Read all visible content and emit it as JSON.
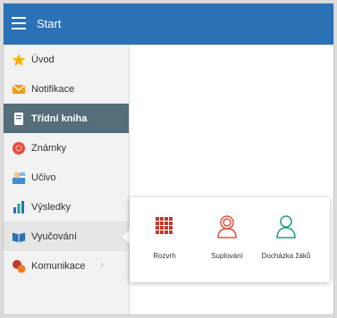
{
  "topbar": {
    "title": "Start",
    "background": "#2a71b5"
  },
  "sidebar": {
    "items": [
      {
        "label": "Úvod",
        "icon": "star-icon"
      },
      {
        "label": "Notifikace",
        "icon": "envelope-icon"
      },
      {
        "label": "Třídní kniha",
        "icon": "book-icon",
        "active": true
      },
      {
        "label": "Známky",
        "icon": "grades-icon"
      },
      {
        "label": "Učivo",
        "icon": "teacher-icon"
      },
      {
        "label": "Výsledky",
        "icon": "bar-chart-icon"
      },
      {
        "label": "Vyučování",
        "icon": "open-book-icon"
      },
      {
        "label": "Komunikace",
        "icon": "chat-icon"
      }
    ],
    "active_color": "#546e7a"
  },
  "submenu": {
    "tiles": [
      {
        "label": "Rozvrh",
        "icon": "calendar-grid-icon",
        "color": "#c0392b"
      },
      {
        "label": "Suplování",
        "icon": "person-substitute-icon",
        "color": "#e74c3c"
      },
      {
        "label": "Docházka žáků",
        "icon": "person-attendance-icon",
        "color": "#16a085"
      }
    ]
  }
}
